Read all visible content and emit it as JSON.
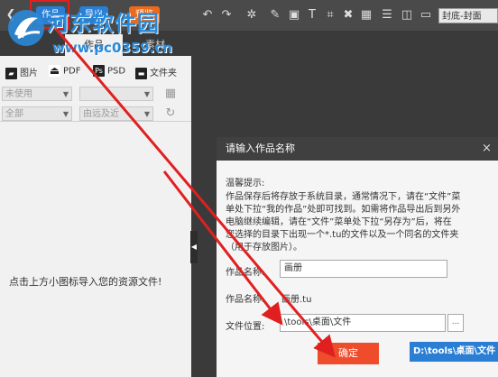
{
  "toolbar": {
    "btn_blue_1": "作品",
    "btn_blue_2": "导出",
    "btn_orange": "预览",
    "icons": [
      "undo-icon",
      "redo-icon",
      "zoom-icon",
      "edit-icon",
      "image-edit-icon",
      "text-icon",
      "crop-icon",
      "delete-icon",
      "grid-icon",
      "book-icon",
      "page-icon"
    ],
    "page_select": "封底-封面"
  },
  "watermark": {
    "title": "河东软件园",
    "url": "www.pc0359.cn"
  },
  "left_panel": {
    "tabs": [
      "作品",
      "素材"
    ],
    "filetypes": [
      {
        "icon": "image-folder-icon",
        "label": "图片"
      },
      {
        "icon": "pdf-icon",
        "label": "PDF"
      },
      {
        "icon": "psd-icon",
        "label": "PSD"
      },
      {
        "icon": "folder-icon",
        "label": "文件夹"
      }
    ],
    "filter_used": "未使用",
    "filter_all": "全部",
    "sort_order": "由远及近",
    "import_hint": "点击上方小图标导入您的资源文件!"
  },
  "dialog": {
    "title": "请输入作品名称",
    "close": "×",
    "tip_heading": "温馨提示:",
    "tip_lines": [
      "作品保存后将存放于系统目录，通常情况下，请在“文件”菜",
      "单处下拉“我的作品”处即可找到。如需将作品导出后到另外",
      "电脑继续编辑，请在“文件”菜单处下拉“另存为”后，将在",
      "您选择的目录下出现一个*.tu的文件以及一个同名的文件夹",
      "（用于存放图片）。"
    ],
    "name_label": "作品名称:",
    "name_value": "画册",
    "filename_label": "作品名称:",
    "filename_value": "画册.tu",
    "location_label": "文件位置:",
    "location_value": "\\tools\\桌面\\文件",
    "browse_label": "...",
    "ok_label": "确定",
    "path_tooltip": "D:\\tools\\桌面\\文件"
  },
  "colors": {
    "toolbar_bg": "#4a4a4a",
    "accent_blue": "#2a7fd4",
    "accent_orange": "#ee4c2a",
    "annotation_red": "#e02020"
  }
}
